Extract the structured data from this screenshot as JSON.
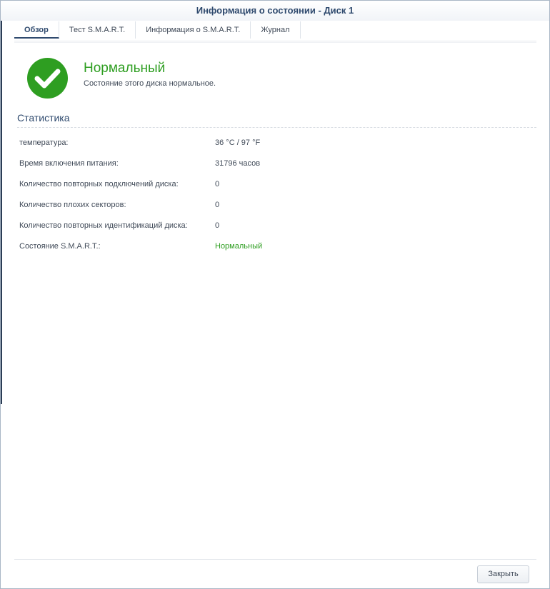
{
  "window": {
    "title": "Информация о состоянии - Диск 1"
  },
  "tabs": [
    {
      "label": "Обзор",
      "active": true
    },
    {
      "label": "Тест S.M.A.R.T.",
      "active": false
    },
    {
      "label": "Информация о S.M.A.R.T.",
      "active": false
    },
    {
      "label": "Журнал",
      "active": false
    }
  ],
  "status": {
    "icon": "check-circle-icon",
    "title": "Нормальный",
    "description": "Состояние этого диска нормальное."
  },
  "statistics": {
    "heading": "Статистика",
    "rows": [
      {
        "label": "температура:",
        "value": "36 °C / 97 °F"
      },
      {
        "label": "Время включения питания:",
        "value": "31796 часов"
      },
      {
        "label": "Количество повторных подключений диска:",
        "value": "0"
      },
      {
        "label": "Количество плохих секторов:",
        "value": "0"
      },
      {
        "label": "Количество повторных идентификаций диска:",
        "value": "0"
      },
      {
        "label": "Состояние S.M.A.R.T.:",
        "value": "Нормальный"
      }
    ]
  },
  "footer": {
    "close_label": "Закрыть"
  },
  "colors": {
    "accent": "#2f4a6e",
    "status_good": "#2e9e21",
    "text": "#404a58"
  }
}
